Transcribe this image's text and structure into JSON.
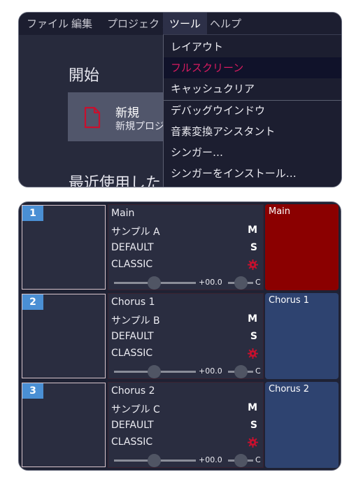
{
  "menubar": {
    "items": [
      {
        "label": "ファイル",
        "active": false
      },
      {
        "label": "編集",
        "active": false
      },
      {
        "label": "プロジェクト",
        "active": false
      },
      {
        "label": "ツール",
        "active": true
      },
      {
        "label": "ヘルプ",
        "active": false
      }
    ]
  },
  "start": {
    "title": "開始",
    "new_card": {
      "title": "新規",
      "desc": "新規プロジ"
    },
    "recent_title": "最近使用した"
  },
  "tools_menu": {
    "items": [
      {
        "label": "レイアウト",
        "highlight": false
      },
      {
        "label": "フルスクリーン",
        "highlight": true
      },
      {
        "label": "キャッシュクリア",
        "highlight": false
      },
      {
        "label": "デバッグウインドウ",
        "highlight": false
      },
      {
        "label": "音素変換アシスタント",
        "highlight": false
      },
      {
        "label": "シンガー…",
        "highlight": false
      },
      {
        "label": "シンガーをインストール…",
        "highlight": false
      }
    ]
  },
  "tracks": [
    {
      "number": "1",
      "name": "Main",
      "singer": "サンプル A",
      "phonemizer": "DEFAULT",
      "renderer": "CLASSIC",
      "mute_label": "M",
      "solo_label": "S",
      "volume": "+00.0",
      "pan": "C",
      "part_name": "Main",
      "part_color": "#8b0000"
    },
    {
      "number": "2",
      "name": "Chorus 1",
      "singer": "サンプル B",
      "phonemizer": "DEFAULT",
      "renderer": "CLASSIC",
      "mute_label": "M",
      "solo_label": "S",
      "volume": "+00.0",
      "pan": "C",
      "part_name": "Chorus 1",
      "part_color": "#2e4370"
    },
    {
      "number": "3",
      "name": "Chorus 2",
      "singer": "サンプル C",
      "phonemizer": "DEFAULT",
      "renderer": "CLASSIC",
      "mute_label": "M",
      "solo_label": "S",
      "volume": "+00.0",
      "pan": "C",
      "part_name": "Chorus 2",
      "part_color": "#2e4370"
    }
  ],
  "colors": {
    "accent": "#d81b60",
    "renderer_icon": "#c8102e",
    "track_number_bg": "#4a8fd4",
    "doc_icon": "#c8102e"
  },
  "icons": {
    "new_project": "document-icon",
    "renderer_settings": "gear-icon"
  }
}
